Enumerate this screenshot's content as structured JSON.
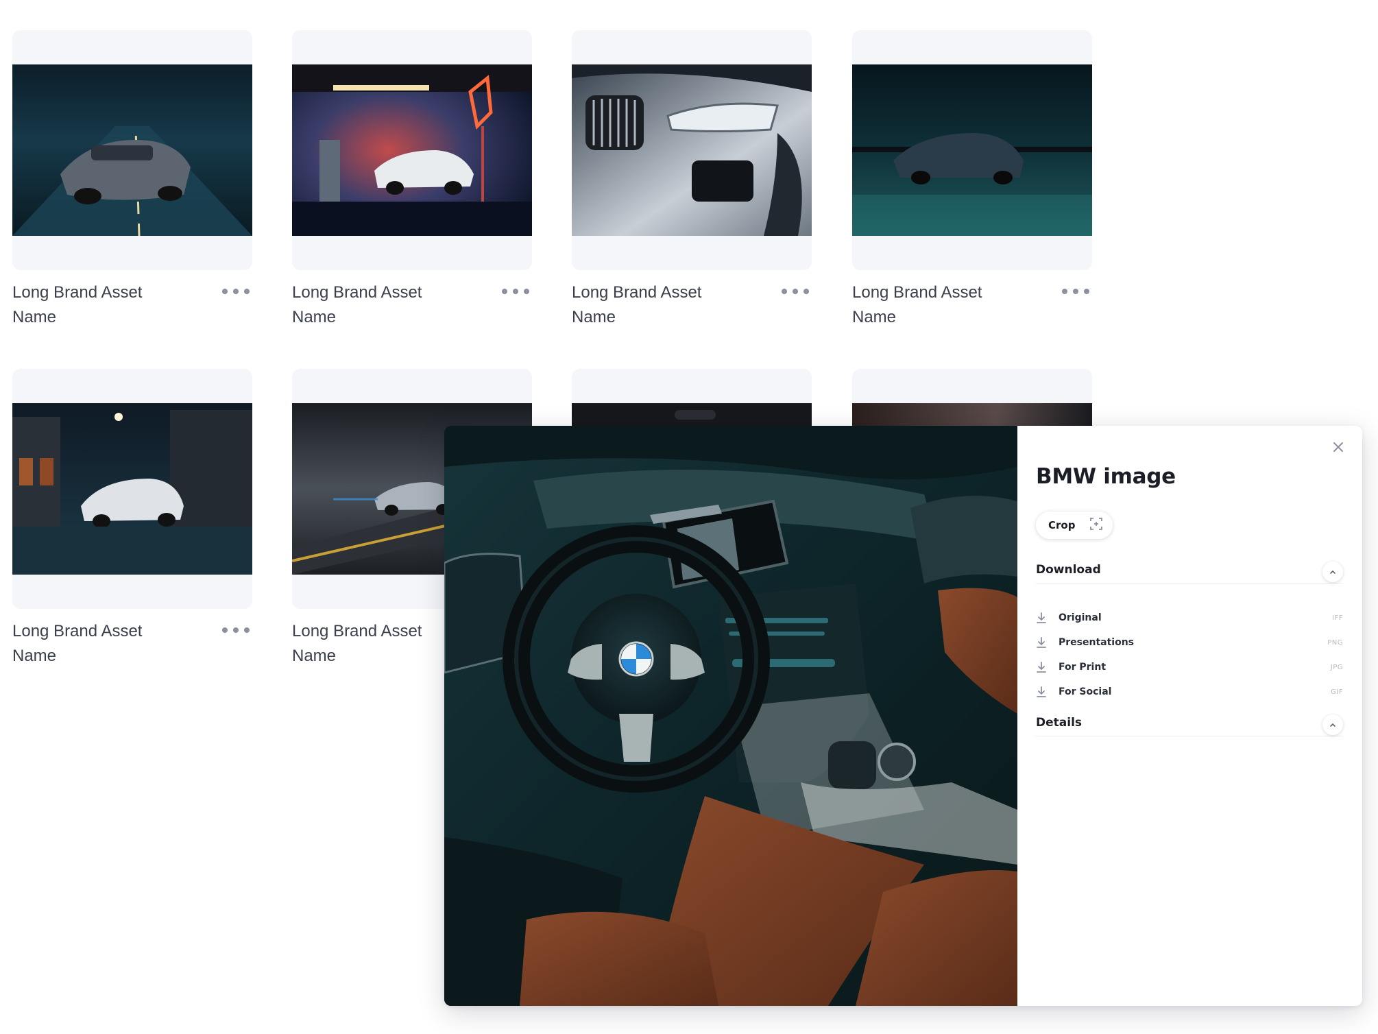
{
  "grid": {
    "cards": [
      {
        "name": "Long Brand Asset Name",
        "image": "bmw-8-series-night-road"
      },
      {
        "name": "Long Brand Asset Name",
        "image": "bmw-x5-gas-station"
      },
      {
        "name": "Long Brand Asset Name",
        "image": "bmw-x5-front-headlight"
      },
      {
        "name": "Long Brand Asset Name",
        "image": "bmw-8-series-coast-night"
      },
      {
        "name": "Long Brand Asset Name",
        "image": "bmw-x5-city-street"
      },
      {
        "name": "Long Brand Asset Name",
        "image": "bmw-5-series-motion-blur"
      },
      {
        "name": "",
        "image": "bmw-dark-detail"
      },
      {
        "name": "",
        "image": "bmw-dark-road"
      }
    ]
  },
  "modal": {
    "preview_image": "bmw-8-series-interior-cockpit",
    "title": "BMW image",
    "crop_label": "Crop",
    "download": {
      "title": "Download",
      "items": [
        {
          "label": "Original",
          "format": "IFF"
        },
        {
          "label": "Presentations",
          "format": "PNG"
        },
        {
          "label": "For Print",
          "format": "JPG"
        },
        {
          "label": "For Social",
          "format": "GIF"
        }
      ]
    },
    "details": {
      "title": "Details"
    }
  },
  "colors": {
    "card_bg": "#f5f6fa",
    "text_primary": "#1b1e26",
    "text_muted": "#b6bac4"
  }
}
